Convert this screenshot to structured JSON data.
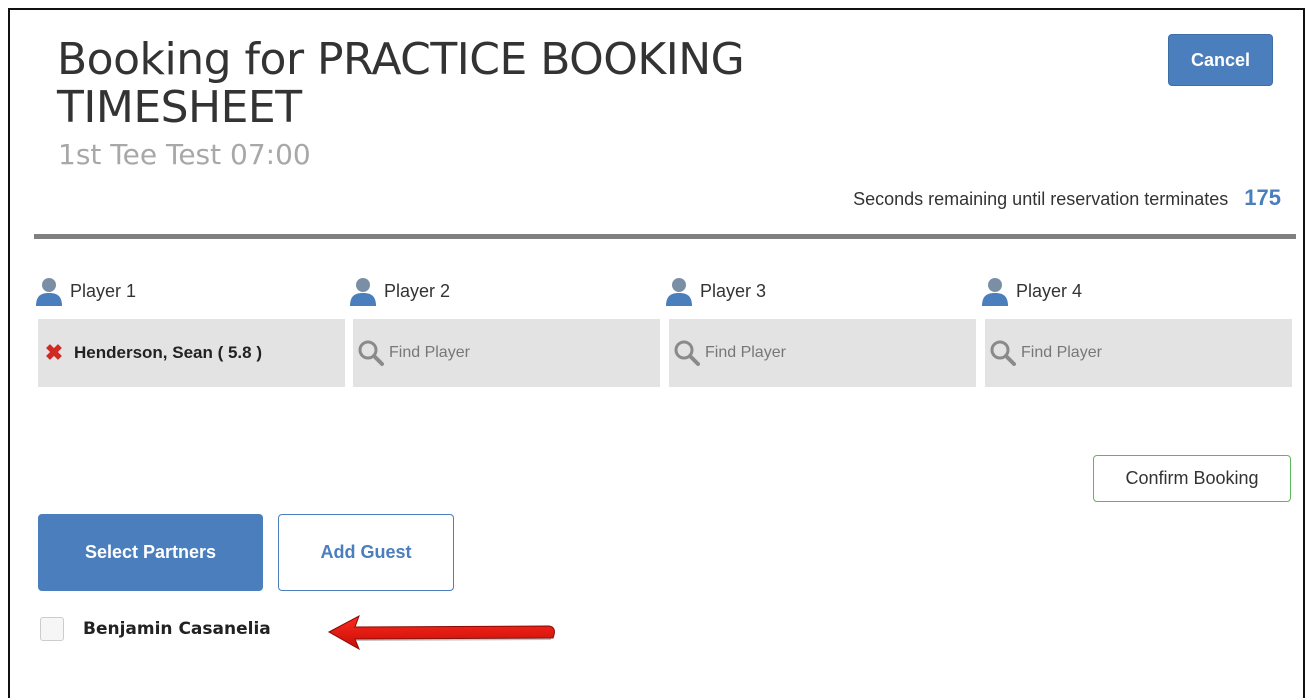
{
  "header": {
    "title": "Booking for PRACTICE BOOKING TIMESHEET",
    "subtitle": "1st Tee Test 07:00",
    "cancel_label": "Cancel"
  },
  "timer": {
    "label": "Seconds remaining until reservation terminates",
    "value": "175"
  },
  "players": [
    {
      "label": "Player 1",
      "name": "Henderson, Sean ( 5.8 )"
    },
    {
      "label": "Player 2",
      "placeholder": "Find Player"
    },
    {
      "label": "Player 3",
      "placeholder": "Find Player"
    },
    {
      "label": "Player 4",
      "placeholder": "Find Player"
    }
  ],
  "actions": {
    "confirm_label": "Confirm Booking",
    "select_partners_label": "Select Partners",
    "add_guest_label": "Add Guest"
  },
  "partners": [
    {
      "name": "Benjamin Casanelia",
      "checked": false
    }
  ],
  "colors": {
    "primary": "#4a7ebd",
    "success_border": "#5cb85c",
    "remove": "#d02a22",
    "annotation_arrow": "#e8120c"
  },
  "icons": {
    "player": "user-icon",
    "search": "search-icon",
    "remove": "close-icon"
  }
}
